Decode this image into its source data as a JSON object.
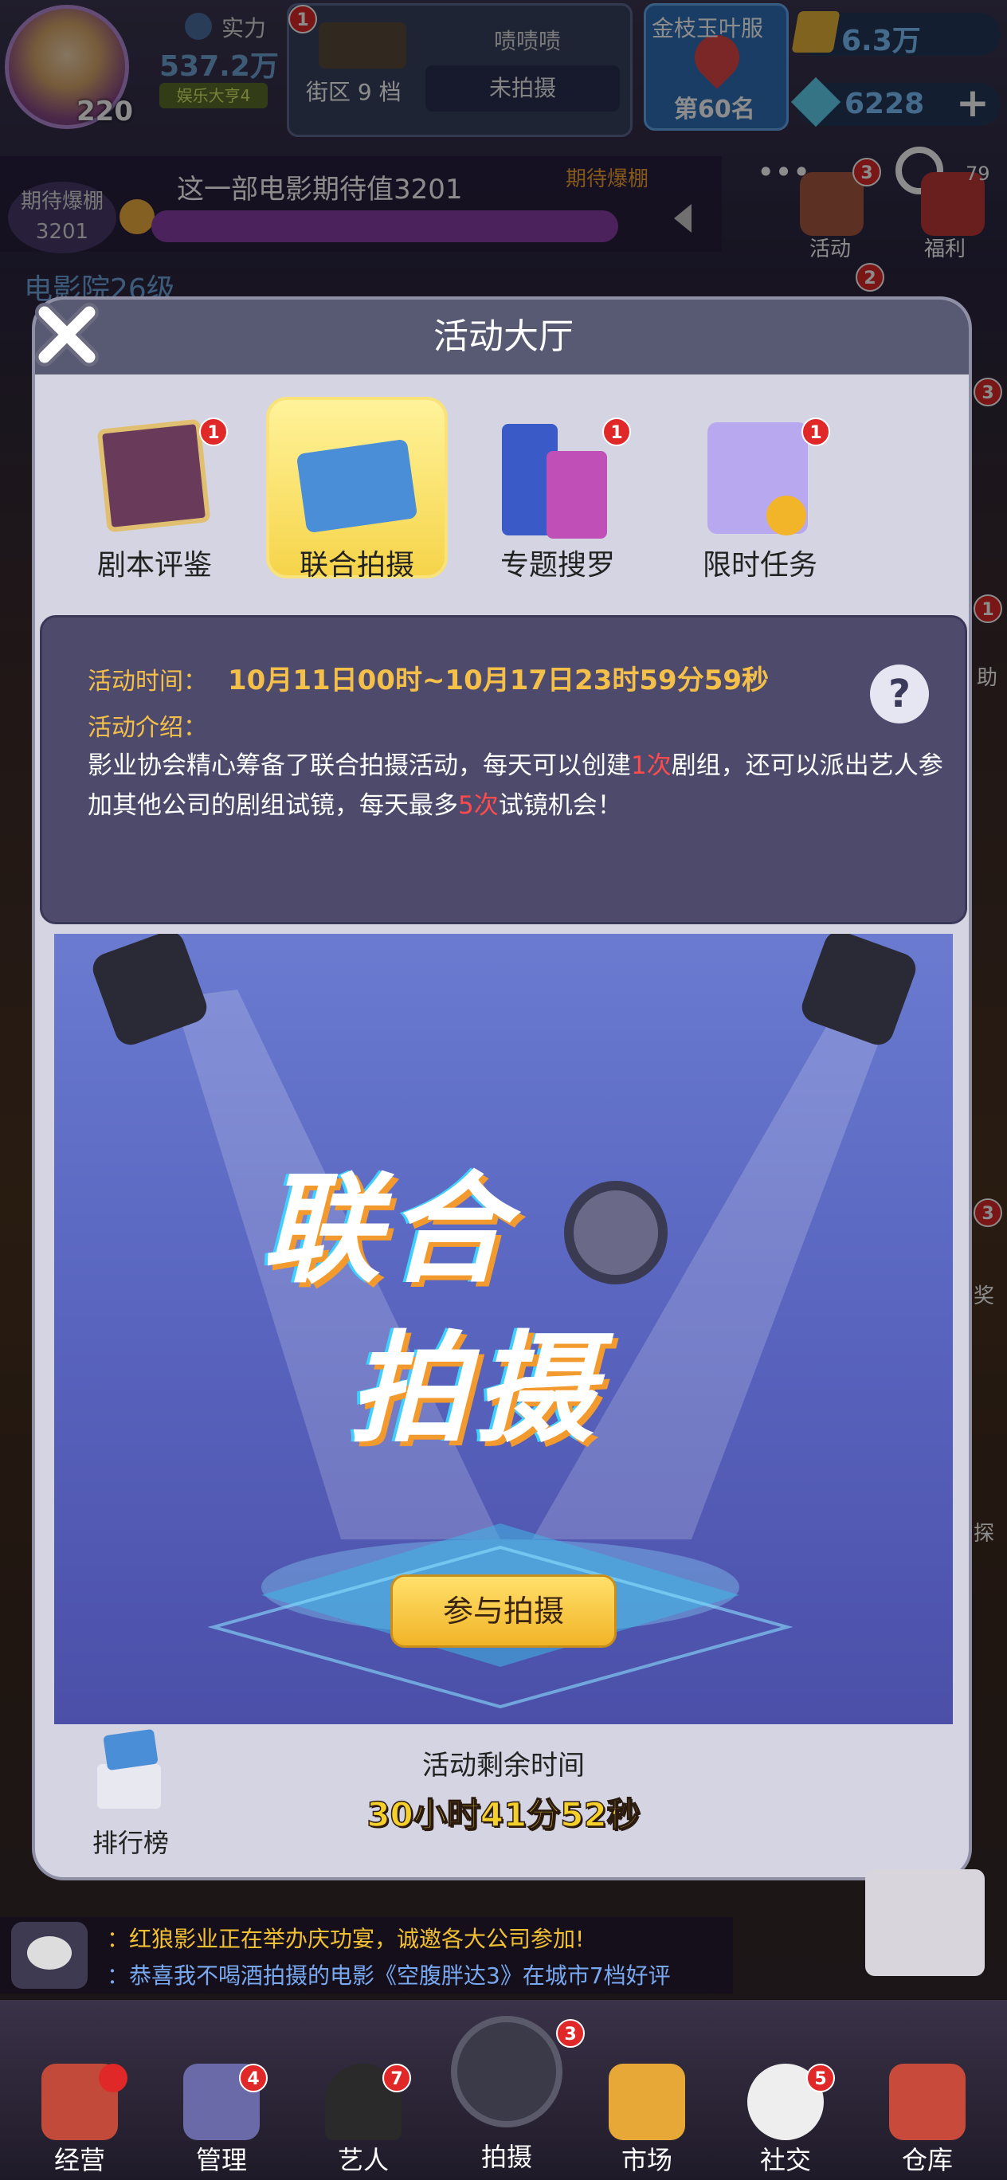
{
  "top_bar": {
    "level": "220",
    "power_label": "实力",
    "power_value": "537.2万",
    "power_tag": "娱乐大亨4",
    "district_badge": "1",
    "district_label": "街区 9 档",
    "district_film": "啧啧啧",
    "district_status": "未拍摄",
    "rank_name": "金枝玉叶服",
    "rank_value": "第60名",
    "currency1": "6.3万",
    "currency2": "6228",
    "plus": "+"
  },
  "expectation": {
    "label_line1": "期待爆棚",
    "label_line2": "3201",
    "text": "这一部电影期待值3201",
    "pointer": "期待爆棚"
  },
  "side": {
    "activity_label": "活动",
    "activity_badge": "3",
    "welfare_label": "福利",
    "welfare_badge": "79",
    "badge2": "2",
    "right_badge_a": "3",
    "right_badge_b": "1",
    "right_text_a": "助",
    "right_badge_c": "3",
    "right_text_b": "奖",
    "right_text_c": "探",
    "cinema_text": "电影院26级"
  },
  "modal": {
    "title": "活动大厅",
    "tabs": [
      {
        "label": "剧本评鉴",
        "badge": "1",
        "active": false
      },
      {
        "label": "联合拍摄",
        "badge": "",
        "active": true
      },
      {
        "label": "专题搜罗",
        "badge": "1",
        "active": false
      },
      {
        "label": "限时任务",
        "badge": "1",
        "active": false
      }
    ],
    "info": {
      "time_label": "活动时间：",
      "time_value": "10月11日00时~10月17日23时59分59秒",
      "intro_label": "活动介绍：",
      "intro_part1": "影业协会精心筹备了联合拍摄活动，每天可以创建",
      "intro_hl1": "1次",
      "intro_part2": "剧组，还可以派出艺人参加其他公司的剧组试镜，每天最多",
      "intro_hl2": "5次",
      "intro_part3": "试镜机会！",
      "help": "?"
    },
    "banner": {
      "title_line1": "联合",
      "title_line2": "拍摄",
      "join_button": "参与拍摄"
    },
    "leaderboard_label": "排行榜",
    "remaining_label": "活动剩余时间",
    "remaining_value": "30小时41分52秒"
  },
  "ticker": {
    "line1": "：红狼影业正在举办庆功宴，诚邀各大公司参加!",
    "line2": "：恭喜我不喝酒拍摄的电影《空腹胖达3》在城市7档好评"
  },
  "bottom_nav": [
    {
      "label": "经营",
      "badge": ""
    },
    {
      "label": "管理",
      "badge": "4"
    },
    {
      "label": "艺人",
      "badge": "7"
    },
    {
      "label": "拍摄",
      "badge": "3"
    },
    {
      "label": "市场",
      "badge": ""
    },
    {
      "label": "社交",
      "badge": "5"
    },
    {
      "label": "仓库",
      "badge": ""
    }
  ],
  "colors": {
    "accent_gold": "#f5c04a",
    "highlight_red": "#ff4b4b",
    "modal_bg": "#d4d4e2",
    "header_bg": "#585a74"
  }
}
